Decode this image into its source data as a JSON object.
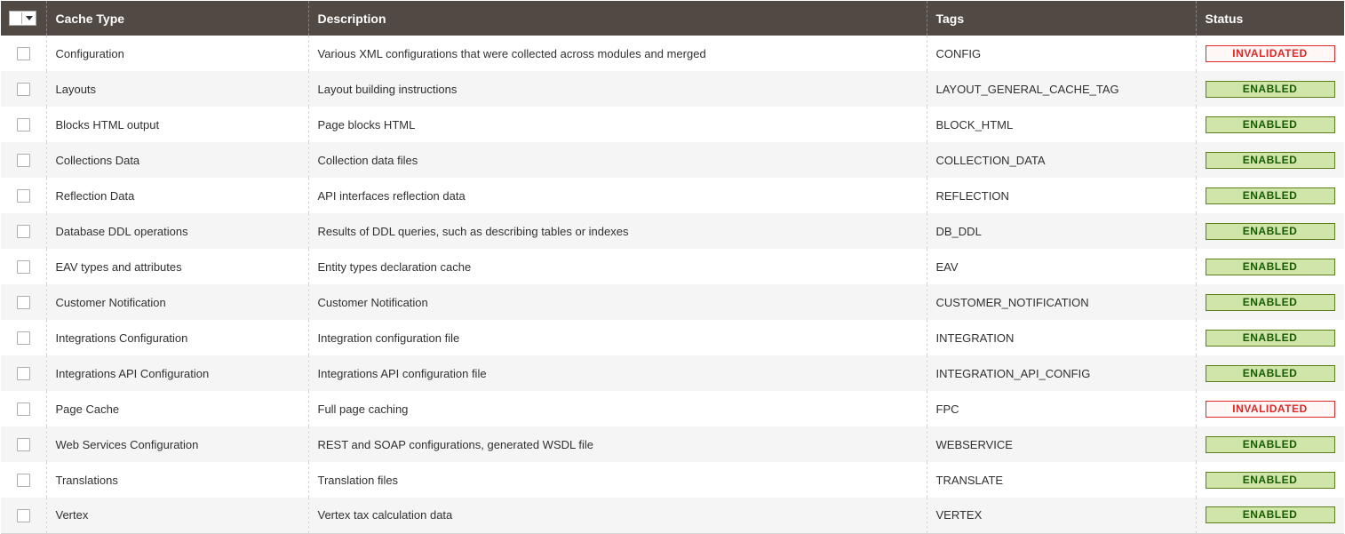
{
  "header": {
    "cache_type": "Cache Type",
    "description": "Description",
    "tags": "Tags",
    "status": "Status"
  },
  "status_colors": {
    "enabled_bg": "#d0e5a9",
    "enabled_border": "#5b8116",
    "enabled_text": "#185b00",
    "invalidated_bg": "#fff8f6",
    "invalidated_border": "#e22626",
    "invalidated_text": "#e22626",
    "header_bg": "#514943"
  },
  "rows": [
    {
      "name": "Configuration",
      "description": "Various XML configurations that were collected across modules and merged",
      "tags": "CONFIG",
      "status": "INVALIDATED"
    },
    {
      "name": "Layouts",
      "description": "Layout building instructions",
      "tags": "LAYOUT_GENERAL_CACHE_TAG",
      "status": "ENABLED"
    },
    {
      "name": "Blocks HTML output",
      "description": "Page blocks HTML",
      "tags": "BLOCK_HTML",
      "status": "ENABLED"
    },
    {
      "name": "Collections Data",
      "description": "Collection data files",
      "tags": "COLLECTION_DATA",
      "status": "ENABLED"
    },
    {
      "name": "Reflection Data",
      "description": "API interfaces reflection data",
      "tags": "REFLECTION",
      "status": "ENABLED"
    },
    {
      "name": "Database DDL operations",
      "description": "Results of DDL queries, such as describing tables or indexes",
      "tags": "DB_DDL",
      "status": "ENABLED"
    },
    {
      "name": "EAV types and attributes",
      "description": "Entity types declaration cache",
      "tags": "EAV",
      "status": "ENABLED"
    },
    {
      "name": "Customer Notification",
      "description": "Customer Notification",
      "tags": "CUSTOMER_NOTIFICATION",
      "status": "ENABLED"
    },
    {
      "name": "Integrations Configuration",
      "description": "Integration configuration file",
      "tags": "INTEGRATION",
      "status": "ENABLED"
    },
    {
      "name": "Integrations API Configuration",
      "description": "Integrations API configuration file",
      "tags": "INTEGRATION_API_CONFIG",
      "status": "ENABLED"
    },
    {
      "name": "Page Cache",
      "description": "Full page caching",
      "tags": "FPC",
      "status": "INVALIDATED"
    },
    {
      "name": "Web Services Configuration",
      "description": "REST and SOAP configurations, generated WSDL file",
      "tags": "WEBSERVICE",
      "status": "ENABLED"
    },
    {
      "name": "Translations",
      "description": "Translation files",
      "tags": "TRANSLATE",
      "status": "ENABLED"
    },
    {
      "name": "Vertex",
      "description": "Vertex tax calculation data",
      "tags": "VERTEX",
      "status": "ENABLED"
    }
  ]
}
